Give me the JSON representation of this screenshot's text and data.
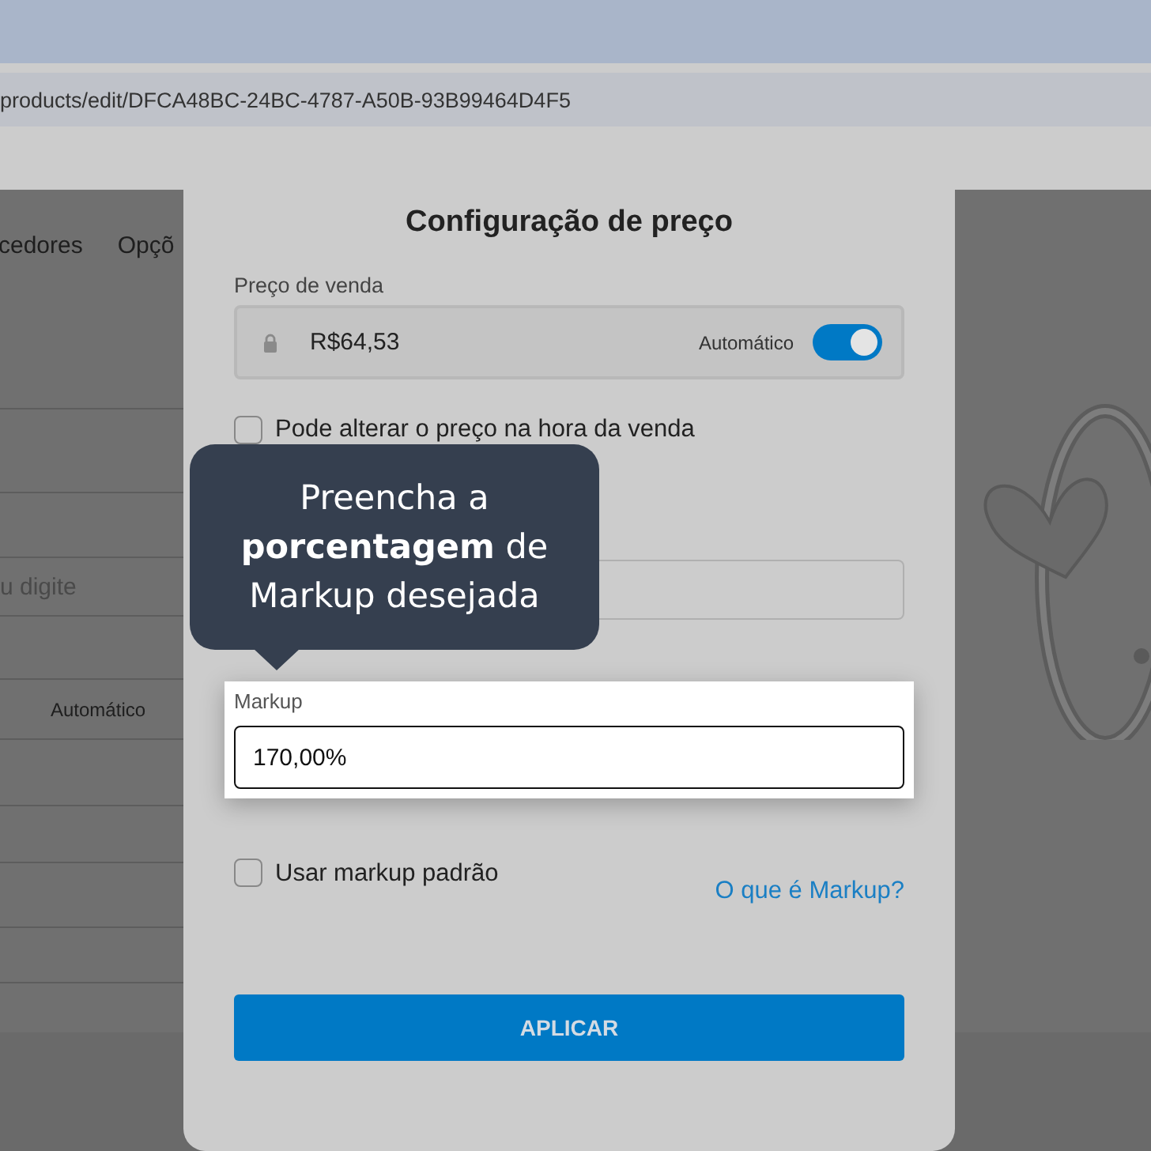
{
  "browser": {
    "url": "products/edit/DFCA48BC-24BC-4787-A50B-93B99464D4F5"
  },
  "background_page": {
    "tabs": [
      "cedores",
      "Opçõ"
    ],
    "field_placeholder": "u digite",
    "toggle_label": "Automático"
  },
  "modal": {
    "title": "Configuração de preço",
    "sale_price": {
      "label": "Preço de venda",
      "value": "R$64,53",
      "auto_label": "Automático",
      "auto_on": true
    },
    "can_change_checkbox": {
      "label": "Pode alterar o preço na hora da venda",
      "checked": false
    },
    "markup": {
      "label": "Markup",
      "value": "170,00%"
    },
    "default_markup_checkbox": {
      "label": "Usar markup padrão",
      "checked": false
    },
    "help_link": "O que é Markup?",
    "apply_button": "APLICAR"
  },
  "callout": {
    "text": "Preencha a **porcentagem** de Markup desejada"
  }
}
